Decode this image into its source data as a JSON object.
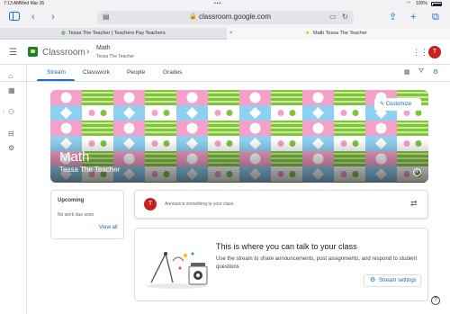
{
  "status_bar": {
    "time": "7:13 AM",
    "date": "Wed Mar 26",
    "dots": "•••",
    "battery": "100%"
  },
  "browser": {
    "url": "classroom.google.com",
    "tabs": [
      {
        "title": "Tessa The Teacher | Teachers Pay Teachers"
      },
      {
        "title": "Math Tessa The Teacher"
      }
    ]
  },
  "header": {
    "brand": "Classroom",
    "class_name": "Math",
    "class_teacher": "Tessa The Teacher",
    "avatar_initial": "T"
  },
  "nav": {
    "tabs": [
      "Stream",
      "Classwork",
      "People",
      "Grades"
    ],
    "active": "Stream"
  },
  "banner": {
    "title": "Math",
    "subtitle": "Tessa The Teacher",
    "customize_label": "Customize",
    "info_glyph": "i",
    "colors": [
      "#f4a0c8",
      "#7ec441",
      "#8fd0f0",
      "#ffffff"
    ]
  },
  "upcoming": {
    "title": "Upcoming",
    "text": "No work due soon",
    "link": "View all"
  },
  "announce": {
    "avatar_initial": "T",
    "placeholder": "Announce something to your class"
  },
  "empty_state": {
    "title": "This is where you can talk to your class",
    "description": "Use the stream to share announcements, post assignments, and respond to student questions",
    "button_label": "Stream settings"
  },
  "help_glyph": "?"
}
